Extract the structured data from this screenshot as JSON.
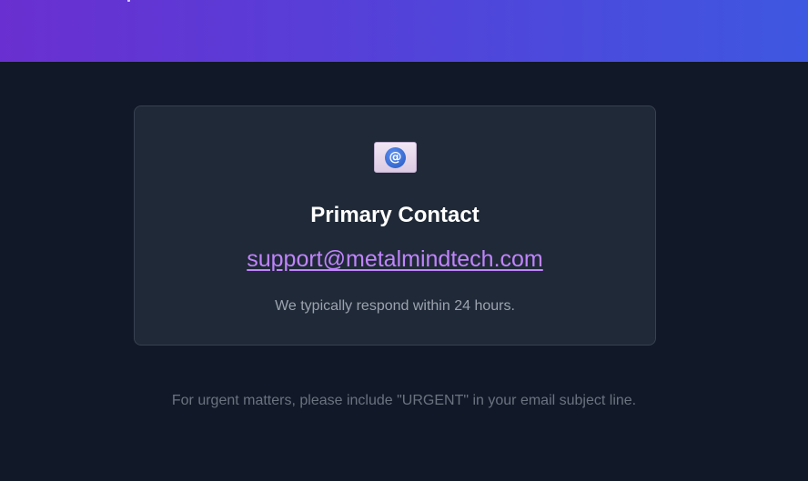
{
  "colors": {
    "page_background": "#111827",
    "header_gradient_start": "#6a2fd0",
    "header_gradient_end": "#3e57e1",
    "card_background": "#1f2937",
    "card_border": "#374151",
    "title_text": "#ffffff",
    "link": "#c084fc",
    "muted_text": "#9ca3af",
    "footer_text": "#6b7280"
  },
  "card": {
    "icon": "email-at-icon",
    "title": "Primary Contact",
    "email": "support@metalmindtech.com",
    "note": "We typically respond within 24 hours."
  },
  "footer": {
    "note": "For urgent matters, please include \"URGENT\" in your email subject line."
  }
}
